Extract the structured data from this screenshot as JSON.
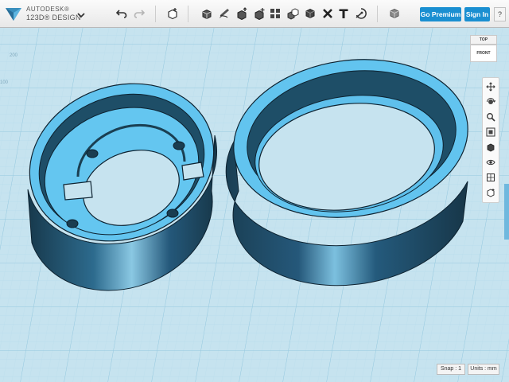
{
  "app": {
    "brand_line1": "AUTODESK®",
    "brand_line2": "123D® DESIGN"
  },
  "toolbar": {
    "icons": [
      "undo-icon",
      "redo-icon",
      "primitives-icon",
      "sketch-icon",
      "construct-icon",
      "modify-icon",
      "pattern-icon",
      "group-icon",
      "combine-icon",
      "measure-icon",
      "text-icon",
      "snap-icon",
      "material-icon"
    ],
    "premium_label": "Go Premium",
    "signin_label": "Sign In",
    "help_label": "?"
  },
  "viewcube": {
    "top_label": "TOP",
    "front_label": "FRONT"
  },
  "navbar": {
    "icons": [
      "pan-icon",
      "orbit-icon",
      "zoom-icon",
      "fit-icon",
      "shaded-view-icon",
      "visibility-icon",
      "grid-icon",
      "material-view-icon"
    ]
  },
  "viewport": {
    "ruler_a": "200",
    "ruler_b": "100"
  },
  "status": {
    "snap": "Snap : 1",
    "units": "Units : mm"
  },
  "colors": {
    "accent": "#1a8fd1",
    "background": "#c6e3ef",
    "grid_line": "#a7d2e6",
    "part_top": "#61c3ee",
    "part_side": "#1d4960"
  }
}
